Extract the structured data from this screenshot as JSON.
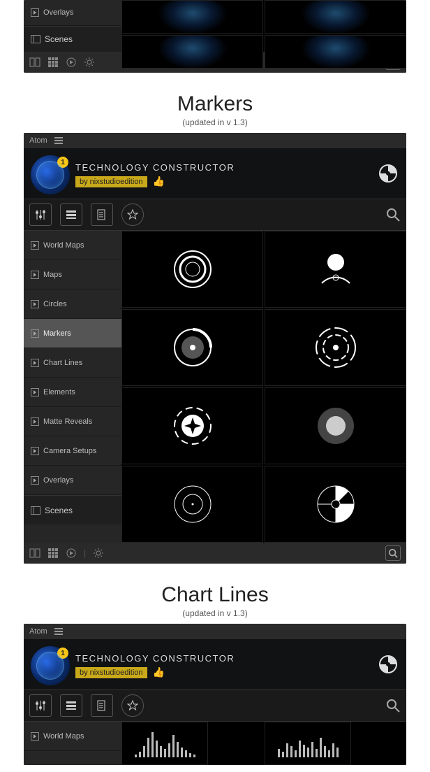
{
  "fragment_top": {
    "sidebar": {
      "overlays": "Overlays",
      "scenes": "Scenes"
    }
  },
  "section_markers": {
    "title": "Markers",
    "subtitle": "(updated in v 1.3)"
  },
  "panel": {
    "top_label": "Atom",
    "badge_number": "1",
    "brand_title": "TECHNOLOGY CONSTRUCTOR",
    "brand_author": "by nixstudioedition",
    "sidebar_items": [
      "World Maps",
      "Maps",
      "Circles",
      "Markers",
      "Chart Lines",
      "Elements",
      "Matte Reveals",
      "Camera Setups",
      "Overlays"
    ],
    "scenes_label": "Scenes"
  },
  "section_chartlines": {
    "title": "Chart Lines",
    "subtitle": "(updated in v 1.3)"
  },
  "panel2": {
    "top_label": "Atom",
    "badge_number": "1",
    "brand_title": "TECHNOLOGY CONSTRUCTOR",
    "brand_author": "by nixstudioedition",
    "sidebar_first": "World Maps"
  }
}
